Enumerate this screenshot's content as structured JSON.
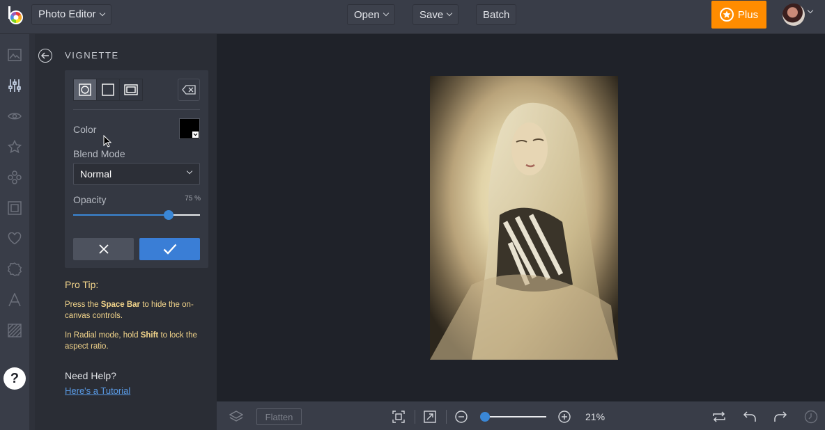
{
  "topbar": {
    "app_menu": "Photo Editor",
    "open_label": "Open",
    "save_label": "Save",
    "batch_label": "Batch",
    "plus_label": "Plus",
    "plus_color": "#ff8c00"
  },
  "sidebar": {
    "icons": [
      "image-icon",
      "adjust-sliders-icon",
      "eye-icon",
      "star-icon",
      "graphics-icon",
      "frame-icon",
      "heart-icon",
      "badge-icon",
      "text-icon",
      "texture-icon"
    ],
    "help_label": "?"
  },
  "panel": {
    "title": "VIGNETTE",
    "shape_modes": [
      "radial",
      "rectangular",
      "frame"
    ],
    "active_mode": "radial",
    "color_label": "Color",
    "color_value": "#000000",
    "blend_label": "Blend Mode",
    "blend_value": "Normal",
    "opacity_label": "Opacity",
    "opacity_text": "75 %",
    "opacity_value": 75,
    "pro_tip_title": "Pro Tip:",
    "tip1_pre": "Press the ",
    "tip1_bold": "Space Bar",
    "tip1_post": " to hide the on-canvas controls.",
    "tip2_pre": "In Radial mode, hold ",
    "tip2_bold": "Shift",
    "tip2_post": " to lock the aspect ratio.",
    "need_help": "Need Help?",
    "tutorial_link": "Here's a Tutorial",
    "accent": "#3a7ed6",
    "tip_color": "#f3d58b"
  },
  "bottombar": {
    "flatten_label": "Flatten",
    "zoom_text": "21%"
  }
}
